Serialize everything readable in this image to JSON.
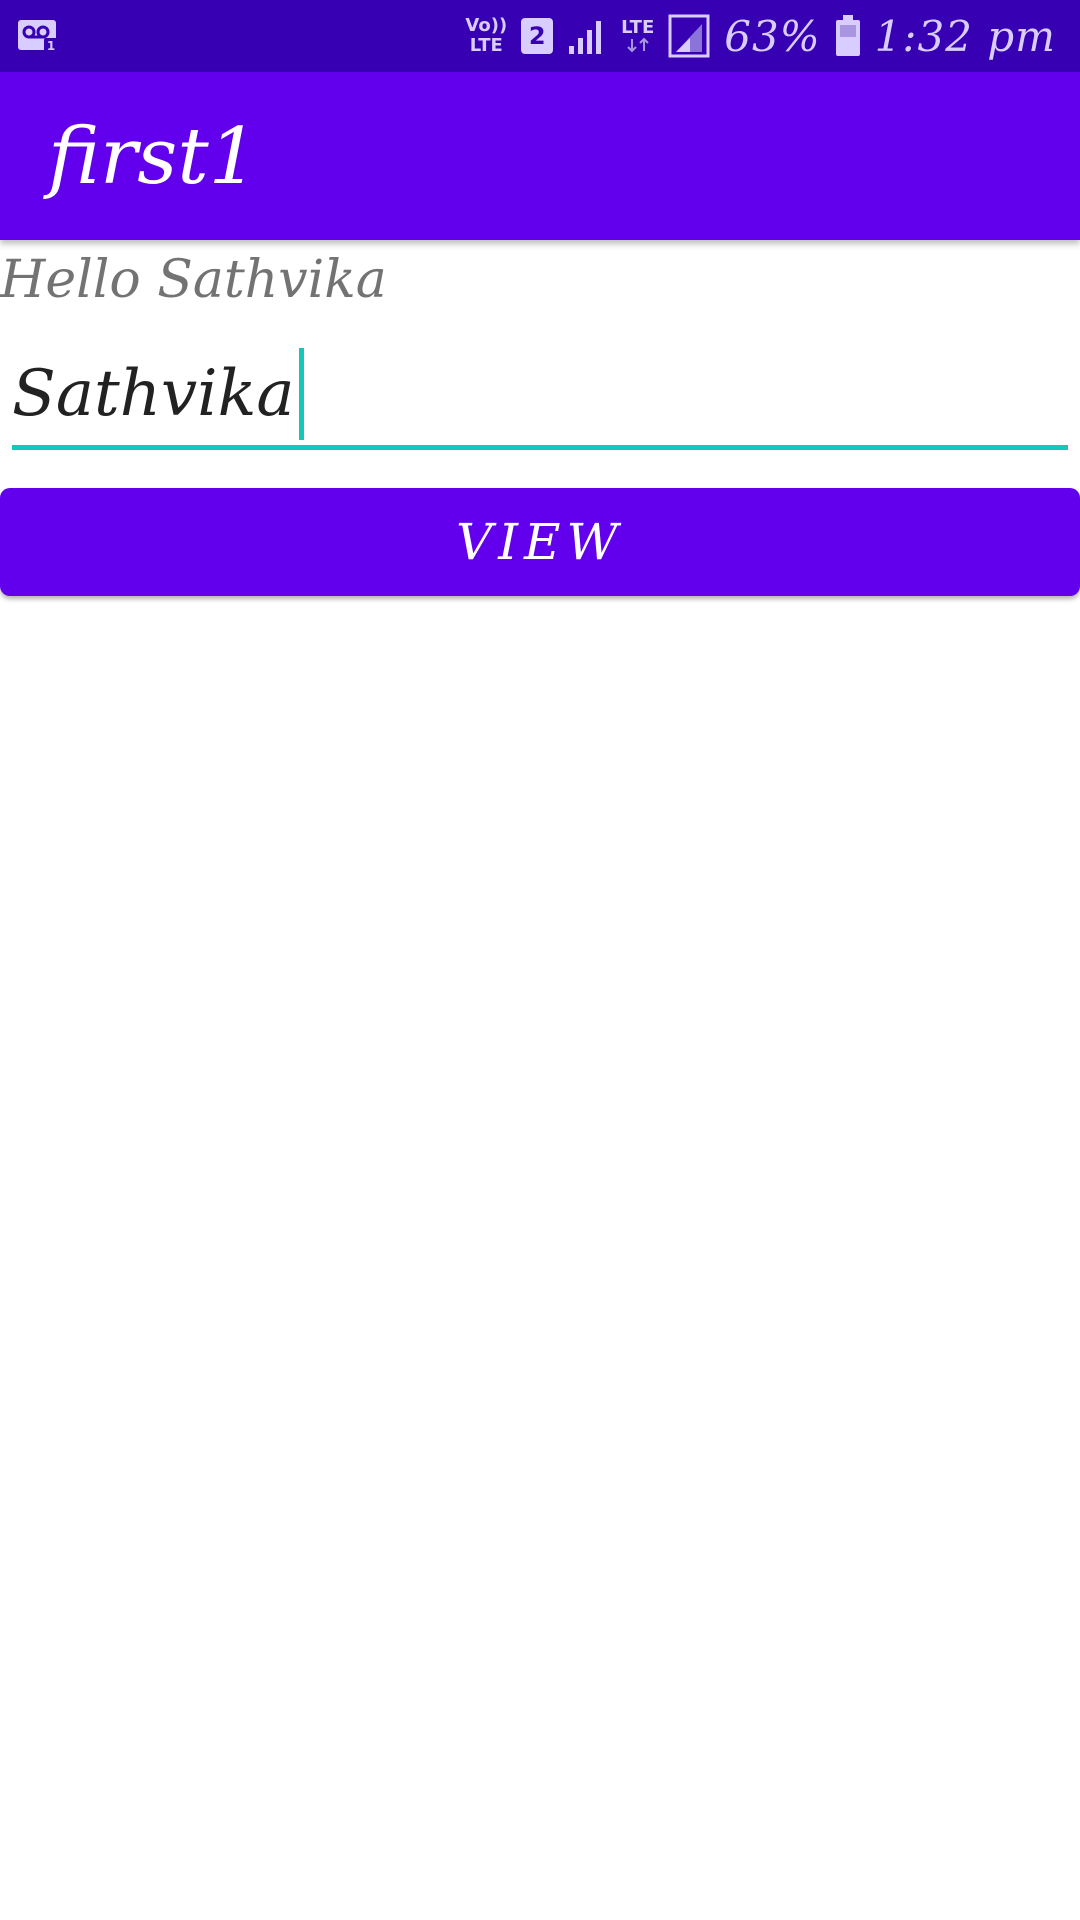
{
  "status_bar": {
    "icons": [
      "voicemail-icon",
      "volte-icon",
      "sim-2-icon",
      "signal-icon",
      "lte-icon",
      "signal-icon-2",
      "battery-icon"
    ],
    "volte_top": "Vo))",
    "volte_bottom": "LTE",
    "sim_number": "2",
    "lte_label": "LTE",
    "battery_percent": "63%",
    "time": "1:32 pm"
  },
  "app_bar": {
    "title": "first1"
  },
  "main": {
    "greeting": "Hello Sathvika",
    "name_input_value": "Sathvika",
    "view_button_label": "VIEW"
  },
  "colors": {
    "status_bar": "#3700b3",
    "primary": "#6200ee",
    "accent": "#14c7b8",
    "greeting_text": "#737373"
  }
}
